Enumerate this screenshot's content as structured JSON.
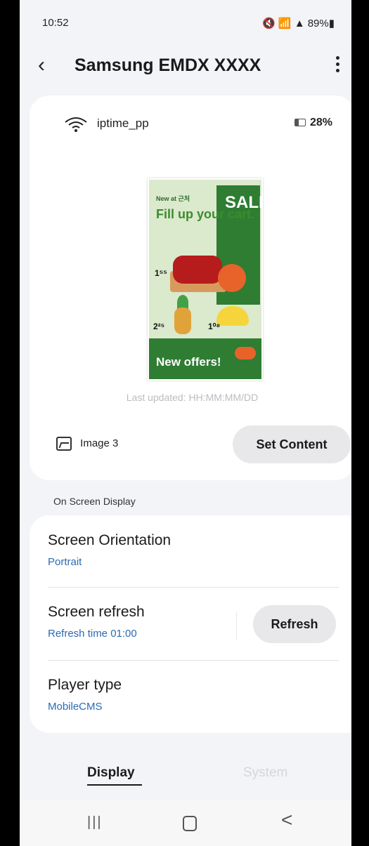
{
  "status_bar": {
    "time": "10:52",
    "left_icons": "🖼 @ ✉ •",
    "right_icons": "🔇 📶 ▲ 89%▮"
  },
  "app_bar": {
    "title": "Samsung EMDX XXXX",
    "back_icon": "back-chevron",
    "more_icon": "more-vert"
  },
  "device_card": {
    "network": "iptime_pp",
    "battery": "28%",
    "poster": {
      "brand": "New at 근처",
      "headline": "Fill up your cart.",
      "side_text": "SALES",
      "price_1": "1⁵⁵",
      "price_2": "2²⁵",
      "price_3": "1⁰⁸",
      "footer": "New offers!"
    },
    "last_updated": "Last updated: HH:MM:MM/DD",
    "image_label": "Image 3",
    "set_content_button": "Set Content"
  },
  "section_label": "On Screen Display",
  "settings": {
    "orientation": {
      "name": "Screen Orientation",
      "value": "Portrait"
    },
    "refresh": {
      "name": "Screen refresh",
      "value": "Refresh time 01:00",
      "button": "Refresh"
    },
    "player": {
      "name": "Player type",
      "value": "MobileCMS"
    }
  },
  "tabs": [
    {
      "label": "Display",
      "selected": true
    },
    {
      "label": "System",
      "selected": false
    }
  ],
  "navbar": {
    "recents": "|||",
    "home": "home",
    "back": "<"
  },
  "colors": {
    "accent_blue": "#2a6bb4",
    "background": "#f2f4f7",
    "button_gray": "#e8e8ea"
  }
}
